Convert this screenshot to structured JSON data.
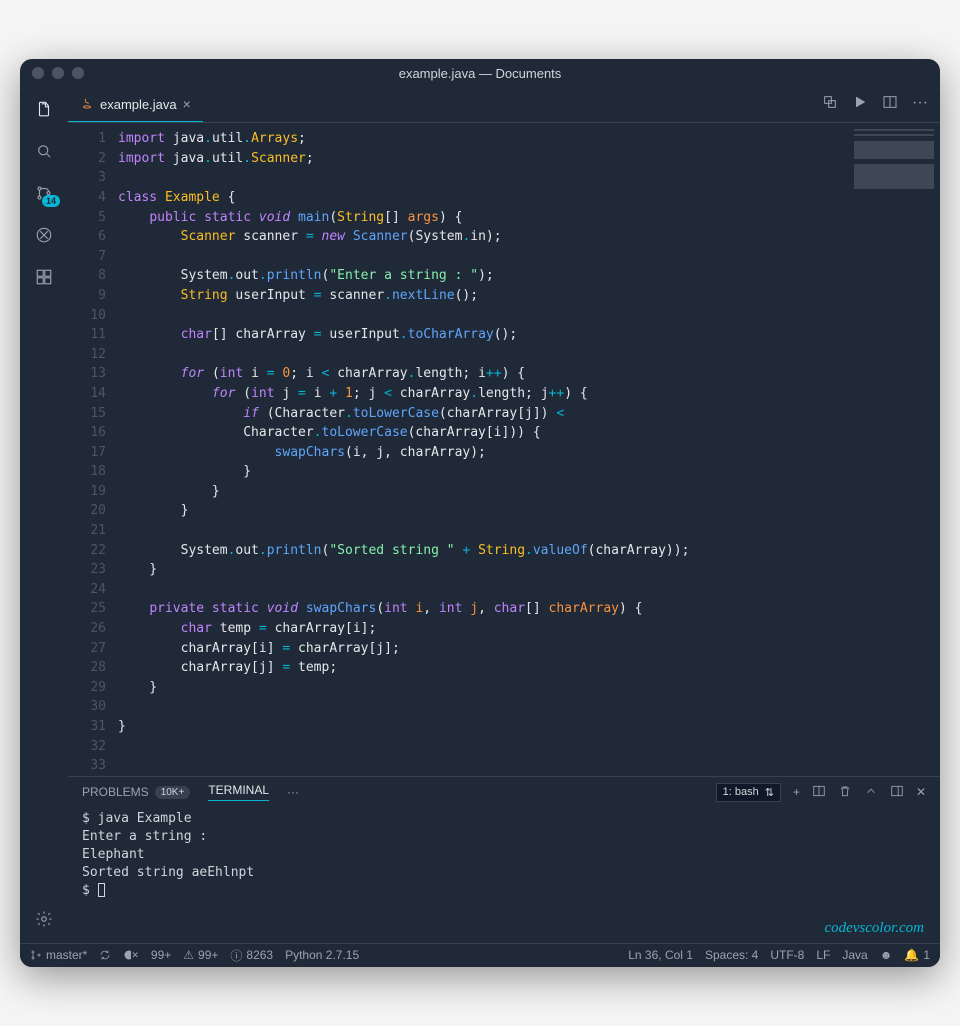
{
  "titlebar": {
    "title": "example.java — Documents"
  },
  "activity": {
    "scm_badge": "14"
  },
  "tab": {
    "filename": "example.java"
  },
  "code": {
    "lines": [
      [
        {
          "t": "import ",
          "c": "c-kw"
        },
        {
          "t": "java",
          "c": "c-pkg"
        },
        {
          "t": ".",
          "c": "c-op"
        },
        {
          "t": "util",
          "c": "c-pkg"
        },
        {
          "t": ".",
          "c": "c-op"
        },
        {
          "t": "Arrays",
          "c": "c-type"
        },
        {
          "t": ";",
          "c": "c-var"
        }
      ],
      [
        {
          "t": "import ",
          "c": "c-kw"
        },
        {
          "t": "java",
          "c": "c-pkg"
        },
        {
          "t": ".",
          "c": "c-op"
        },
        {
          "t": "util",
          "c": "c-pkg"
        },
        {
          "t": ".",
          "c": "c-op"
        },
        {
          "t": "Scanner",
          "c": "c-type"
        },
        {
          "t": ";",
          "c": "c-var"
        }
      ],
      [],
      [
        {
          "t": "class ",
          "c": "c-kw"
        },
        {
          "t": "Example ",
          "c": "c-type"
        },
        {
          "t": "{",
          "c": "c-var"
        }
      ],
      [
        {
          "t": "    ",
          "c": ""
        },
        {
          "t": "public static ",
          "c": "c-kw"
        },
        {
          "t": "void ",
          "c": "c-kw c-ital"
        },
        {
          "t": "main",
          "c": "c-fn"
        },
        {
          "t": "(",
          "c": "c-var"
        },
        {
          "t": "String",
          "c": "c-type"
        },
        {
          "t": "[] ",
          "c": "c-var"
        },
        {
          "t": "args",
          "c": "c-param"
        },
        {
          "t": ") {",
          "c": "c-var"
        }
      ],
      [
        {
          "t": "        ",
          "c": ""
        },
        {
          "t": "Scanner ",
          "c": "c-type"
        },
        {
          "t": "scanner ",
          "c": "c-var"
        },
        {
          "t": "= ",
          "c": "c-op"
        },
        {
          "t": "new ",
          "c": "c-kw c-ital"
        },
        {
          "t": "Scanner",
          "c": "c-fn"
        },
        {
          "t": "(System",
          "c": "c-var"
        },
        {
          "t": ".",
          "c": "c-op"
        },
        {
          "t": "in",
          "c": "c-var"
        },
        {
          "t": ");",
          "c": "c-var"
        }
      ],
      [],
      [
        {
          "t": "        System",
          "c": "c-var"
        },
        {
          "t": ".",
          "c": "c-op"
        },
        {
          "t": "out",
          "c": "c-var"
        },
        {
          "t": ".",
          "c": "c-op"
        },
        {
          "t": "println",
          "c": "c-fn"
        },
        {
          "t": "(",
          "c": "c-var"
        },
        {
          "t": "\"Enter a string : \"",
          "c": "c-str"
        },
        {
          "t": ");",
          "c": "c-var"
        }
      ],
      [
        {
          "t": "        ",
          "c": ""
        },
        {
          "t": "String ",
          "c": "c-type"
        },
        {
          "t": "userInput ",
          "c": "c-var"
        },
        {
          "t": "= ",
          "c": "c-op"
        },
        {
          "t": "scanner",
          "c": "c-var"
        },
        {
          "t": ".",
          "c": "c-op"
        },
        {
          "t": "nextLine",
          "c": "c-fn"
        },
        {
          "t": "();",
          "c": "c-var"
        }
      ],
      [],
      [
        {
          "t": "        ",
          "c": ""
        },
        {
          "t": "char",
          "c": "c-kw"
        },
        {
          "t": "[] charArray ",
          "c": "c-var"
        },
        {
          "t": "= ",
          "c": "c-op"
        },
        {
          "t": "userInput",
          "c": "c-var"
        },
        {
          "t": ".",
          "c": "c-op"
        },
        {
          "t": "toCharArray",
          "c": "c-fn"
        },
        {
          "t": "();",
          "c": "c-var"
        }
      ],
      [],
      [
        {
          "t": "        ",
          "c": ""
        },
        {
          "t": "for ",
          "c": "c-kw c-ital"
        },
        {
          "t": "(",
          "c": "c-var"
        },
        {
          "t": "int ",
          "c": "c-kw"
        },
        {
          "t": "i ",
          "c": "c-var"
        },
        {
          "t": "= ",
          "c": "c-op"
        },
        {
          "t": "0",
          "c": "c-num"
        },
        {
          "t": "; i ",
          "c": "c-var"
        },
        {
          "t": "< ",
          "c": "c-op"
        },
        {
          "t": "charArray",
          "c": "c-var"
        },
        {
          "t": ".",
          "c": "c-op"
        },
        {
          "t": "length; i",
          "c": "c-var"
        },
        {
          "t": "++",
          "c": "c-op"
        },
        {
          "t": ") {",
          "c": "c-var"
        }
      ],
      [
        {
          "t": "            ",
          "c": ""
        },
        {
          "t": "for ",
          "c": "c-kw c-ital"
        },
        {
          "t": "(",
          "c": "c-var"
        },
        {
          "t": "int ",
          "c": "c-kw"
        },
        {
          "t": "j ",
          "c": "c-var"
        },
        {
          "t": "= ",
          "c": "c-op"
        },
        {
          "t": "i ",
          "c": "c-var"
        },
        {
          "t": "+ ",
          "c": "c-op"
        },
        {
          "t": "1",
          "c": "c-num"
        },
        {
          "t": "; j ",
          "c": "c-var"
        },
        {
          "t": "< ",
          "c": "c-op"
        },
        {
          "t": "charArray",
          "c": "c-var"
        },
        {
          "t": ".",
          "c": "c-op"
        },
        {
          "t": "length; j",
          "c": "c-var"
        },
        {
          "t": "++",
          "c": "c-op"
        },
        {
          "t": ") {",
          "c": "c-var"
        }
      ],
      [
        {
          "t": "                ",
          "c": ""
        },
        {
          "t": "if ",
          "c": "c-kw c-ital"
        },
        {
          "t": "(Character",
          "c": "c-var"
        },
        {
          "t": ".",
          "c": "c-op"
        },
        {
          "t": "toLowerCase",
          "c": "c-fn"
        },
        {
          "t": "(charArray[j]) ",
          "c": "c-var"
        },
        {
          "t": "<",
          "c": "c-op"
        }
      ],
      [
        {
          "t": "                Character",
          "c": "c-var"
        },
        {
          "t": ".",
          "c": "c-op"
        },
        {
          "t": "toLowerCase",
          "c": "c-fn"
        },
        {
          "t": "(charArray[i])) {",
          "c": "c-var"
        }
      ],
      [
        {
          "t": "                    ",
          "c": ""
        },
        {
          "t": "swapChars",
          "c": "c-fn"
        },
        {
          "t": "(i, j, charArray);",
          "c": "c-var"
        }
      ],
      [
        {
          "t": "                }",
          "c": "c-var"
        }
      ],
      [
        {
          "t": "            }",
          "c": "c-var"
        }
      ],
      [
        {
          "t": "        }",
          "c": "c-var"
        }
      ],
      [],
      [
        {
          "t": "        System",
          "c": "c-var"
        },
        {
          "t": ".",
          "c": "c-op"
        },
        {
          "t": "out",
          "c": "c-var"
        },
        {
          "t": ".",
          "c": "c-op"
        },
        {
          "t": "println",
          "c": "c-fn"
        },
        {
          "t": "(",
          "c": "c-var"
        },
        {
          "t": "\"Sorted string \"",
          "c": "c-str"
        },
        {
          "t": " + ",
          "c": "c-op"
        },
        {
          "t": "String",
          "c": "c-type"
        },
        {
          "t": ".",
          "c": "c-op"
        },
        {
          "t": "valueOf",
          "c": "c-fn"
        },
        {
          "t": "(charArray));",
          "c": "c-var"
        }
      ],
      [
        {
          "t": "    }",
          "c": "c-var"
        }
      ],
      [],
      [
        {
          "t": "    ",
          "c": ""
        },
        {
          "t": "private static ",
          "c": "c-kw"
        },
        {
          "t": "void ",
          "c": "c-kw c-ital"
        },
        {
          "t": "swapChars",
          "c": "c-fn"
        },
        {
          "t": "(",
          "c": "c-var"
        },
        {
          "t": "int ",
          "c": "c-kw"
        },
        {
          "t": "i",
          "c": "c-param"
        },
        {
          "t": ", ",
          "c": "c-var"
        },
        {
          "t": "int ",
          "c": "c-kw"
        },
        {
          "t": "j",
          "c": "c-param"
        },
        {
          "t": ", ",
          "c": "c-var"
        },
        {
          "t": "char",
          "c": "c-kw"
        },
        {
          "t": "[] ",
          "c": "c-var"
        },
        {
          "t": "charArray",
          "c": "c-param"
        },
        {
          "t": ") {",
          "c": "c-var"
        }
      ],
      [
        {
          "t": "        ",
          "c": ""
        },
        {
          "t": "char ",
          "c": "c-kw"
        },
        {
          "t": "temp ",
          "c": "c-var"
        },
        {
          "t": "= ",
          "c": "c-op"
        },
        {
          "t": "charArray[i];",
          "c": "c-var"
        }
      ],
      [
        {
          "t": "        charArray[i] ",
          "c": "c-var"
        },
        {
          "t": "= ",
          "c": "c-op"
        },
        {
          "t": "charArray[j];",
          "c": "c-var"
        }
      ],
      [
        {
          "t": "        charArray[j] ",
          "c": "c-var"
        },
        {
          "t": "= ",
          "c": "c-op"
        },
        {
          "t": "temp;",
          "c": "c-var"
        }
      ],
      [
        {
          "t": "    }",
          "c": "c-var"
        }
      ],
      [],
      [
        {
          "t": "}",
          "c": "c-var"
        }
      ],
      [],
      []
    ]
  },
  "panel": {
    "problems_label": "PROBLEMS",
    "problems_badge": "10K+",
    "terminal_label": "TERMINAL",
    "more": "···",
    "term_select": "1: bash",
    "terminal_output": "$ java Example\nEnter a string :\nElephant\nSorted string aeEhlnpt\n$ "
  },
  "watermark": "codevscolor.com",
  "status": {
    "branch": "master*",
    "errors": "99+",
    "warnings": "99+",
    "info": "8263",
    "python": "Python 2.7.15",
    "cursor": "Ln 36, Col 1",
    "spaces": "Spaces: 4",
    "encoding": "UTF-8",
    "eol": "LF",
    "lang": "Java",
    "bell": "1"
  }
}
